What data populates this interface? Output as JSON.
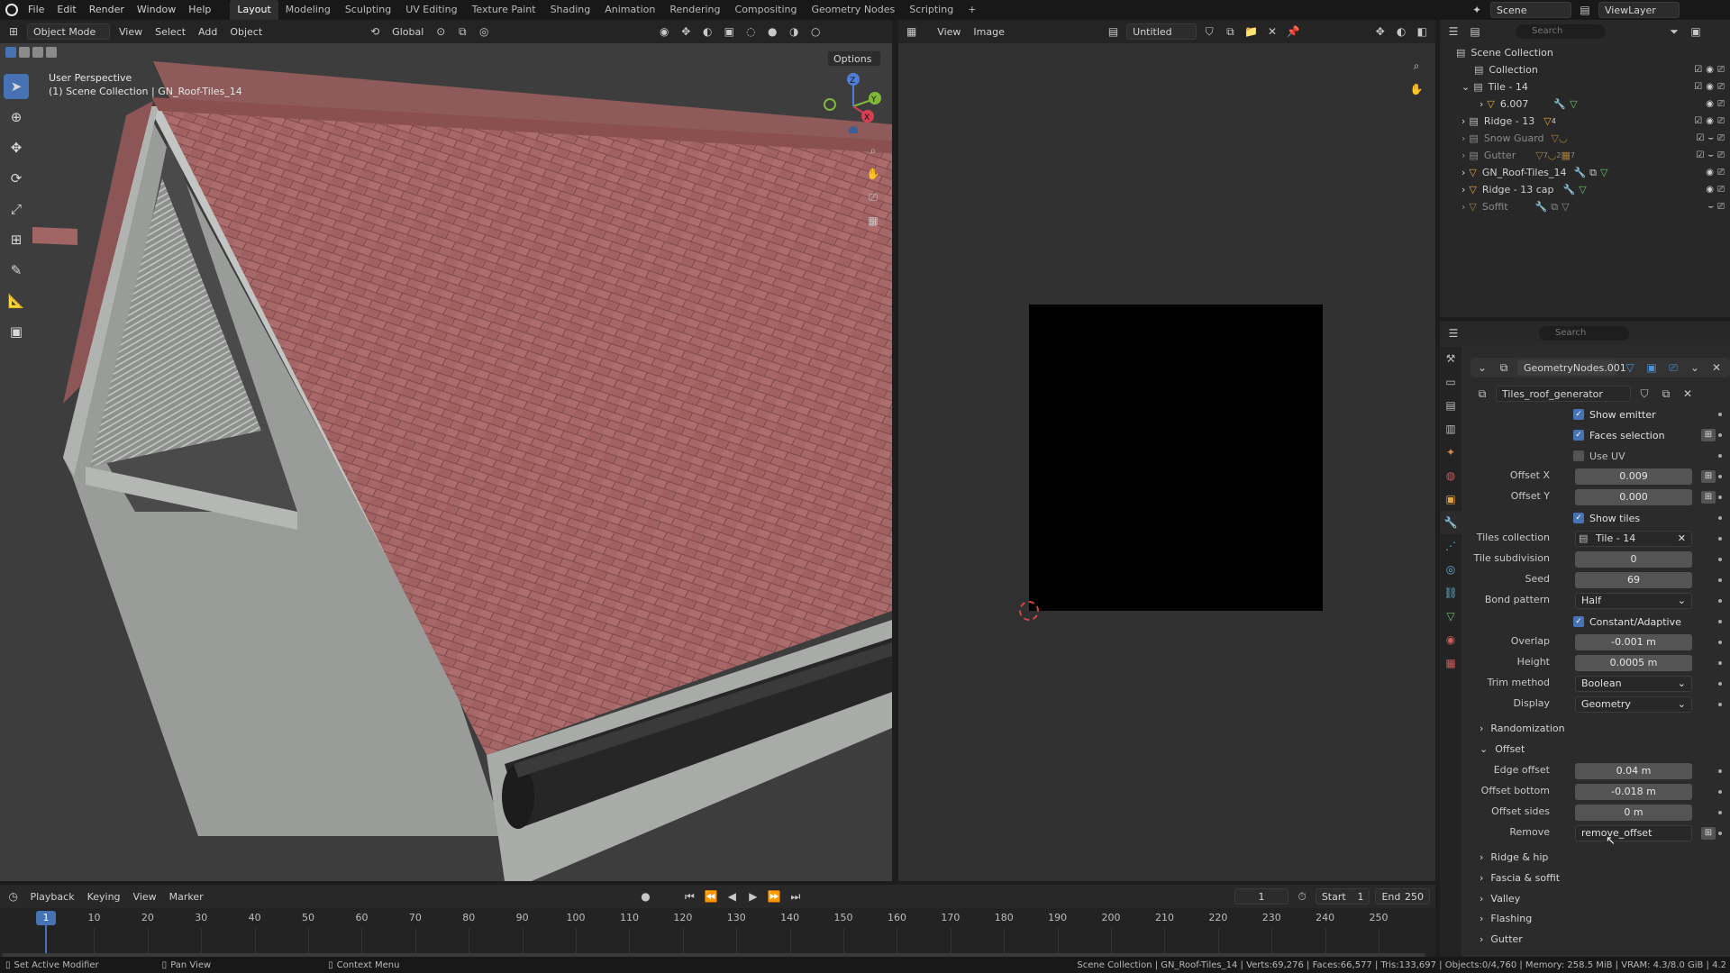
{
  "topbar": {
    "menus": [
      "File",
      "Edit",
      "Render",
      "Window",
      "Help"
    ],
    "workspaces": [
      "Layout",
      "Modeling",
      "Sculpting",
      "UV Editing",
      "Texture Paint",
      "Shading",
      "Animation",
      "Rendering",
      "Compositing",
      "Geometry Nodes",
      "Scripting"
    ],
    "active_workspace": "Layout",
    "add_tab": "+",
    "scene": "Scene",
    "view_layer": "ViewLayer"
  },
  "viewport_header": {
    "mode": "Object Mode",
    "menus": [
      "View",
      "Select",
      "Add",
      "Object"
    ],
    "transform": "Global",
    "options": "Options"
  },
  "viewport": {
    "perspective": "User Perspective",
    "context": "(1) Scene Collection | GN_Roof-Tiles_14",
    "axes": {
      "x": "X",
      "y": "Y",
      "z": "Z"
    }
  },
  "image_editor": {
    "menus": [
      "View",
      "Image"
    ],
    "image_name": "Untitled"
  },
  "outliner": {
    "search_placeholder": "Search",
    "root": "Scene Collection",
    "rows": [
      {
        "label": "Collection",
        "dim": false
      },
      {
        "label": "Tile - 14",
        "dim": false
      },
      {
        "label": "6.007",
        "dim": false
      },
      {
        "label": "Ridge - 13",
        "dim": false
      },
      {
        "label": "Snow Guard",
        "dim": true
      },
      {
        "label": "Gutter",
        "dim": true
      },
      {
        "label": "GN_Roof-Tiles_14",
        "dim": false
      },
      {
        "label": "Ridge - 13 cap",
        "dim": false
      },
      {
        "label": "Soffit",
        "dim": true
      }
    ],
    "gutter_counts": [
      "7",
      "2",
      "7"
    ],
    "ridge_count": "4"
  },
  "properties": {
    "search_placeholder": "Search",
    "modifier_name": "GeometryNodes.001",
    "node_group": "Tiles_roof_generator",
    "show_emitter": "Show emitter",
    "faces_selection": "Faces selection",
    "use_uv": "Use UV",
    "offset_x_label": "Offset X",
    "offset_x": "0.009",
    "offset_y_label": "Offset Y",
    "offset_y": "0.000",
    "show_tiles": "Show tiles",
    "tiles_collection_label": "Tiles collection",
    "tiles_collection": "Tile - 14",
    "tile_subdivision_label": "Tile subdivision",
    "tile_subdivision": "0",
    "seed_label": "Seed",
    "seed": "69",
    "bond_pattern_label": "Bond pattern",
    "bond_pattern": "Half",
    "constant_adaptive": "Constant/Adaptive",
    "overlap_label": "Overlap",
    "overlap": "-0.001 m",
    "height_label": "Height",
    "height": "0.0005 m",
    "trim_method_label": "Trim method",
    "trim_method": "Boolean",
    "display_label": "Display",
    "display": "Geometry",
    "randomization": "Randomization",
    "offset_section": "Offset",
    "edge_offset_label": "Edge offset",
    "edge_offset": "0.04 m",
    "offset_bottom_label": "Offset bottom",
    "offset_bottom": "-0.018 m",
    "offset_sides_label": "Offset sides",
    "offset_sides": "0 m",
    "remove_label": "Remove",
    "remove": "remove_offset",
    "sections": [
      "Ridge & hip",
      "Fascia & soffit",
      "Valley",
      "Flashing",
      "Gutter"
    ]
  },
  "timeline": {
    "menus": [
      "Playback",
      "Keying",
      "View",
      "Marker"
    ],
    "current_frame": "1",
    "start_label": "Start",
    "start": "1",
    "end_label": "End",
    "end": "250",
    "ticks": [
      "10",
      "20",
      "30",
      "40",
      "50",
      "60",
      "70",
      "80",
      "90",
      "100",
      "110",
      "120",
      "130",
      "140",
      "150",
      "160",
      "170",
      "180",
      "190",
      "200",
      "210",
      "220",
      "230",
      "240",
      "250"
    ],
    "playhead": "1"
  },
  "statusbar": {
    "left1": "Set Active Modifier",
    "left2": "Pan View",
    "left3": "Context Menu",
    "stats": "Scene Collection | GN_Roof-Tiles_14 | Verts:69,276 | Faces:66,577 | Tris:133,697 | Objects:0/4,760 | Memory: 258.5 MiB | VRAM: 4.3/8.0 GiB | 4.2"
  },
  "colors": {
    "accent": "#4772b3",
    "tiles": "#a26565",
    "wall": "#a8aaa8",
    "gutter": "#2a2a2a"
  }
}
